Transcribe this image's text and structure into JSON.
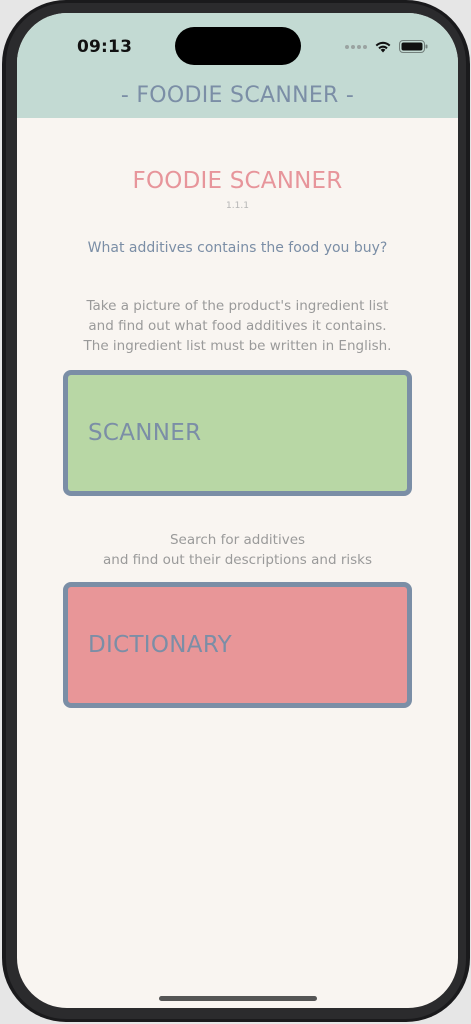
{
  "status_bar": {
    "time": "09:13"
  },
  "header": {
    "title": "- FOODIE SCANNER -"
  },
  "main": {
    "app_title": "FOODIE SCANNER",
    "version": "1.1.1",
    "question": "What additives contains the food you buy?",
    "scanner_description": [
      "Take a picture of the product's ingredient list",
      "and find out what food additives it contains.",
      "The ingredient list must be written in English."
    ],
    "scanner_button": {
      "label": "SCANNER",
      "color": "#b8d7a5"
    },
    "dictionary_description": [
      "Search for additives",
      "and find out their descriptions and risks"
    ],
    "dictionary_button": {
      "label": "DICTIONARY",
      "color": "#e89698"
    }
  },
  "colors": {
    "header_bg": "#c3dad3",
    "accent": "#7b8ea6",
    "title_pink": "#e7959b",
    "background": "#f9f5f1"
  },
  "icons": {
    "signal": "cellular-signal-icon",
    "wifi": "wifi-icon",
    "battery": "battery-icon"
  }
}
